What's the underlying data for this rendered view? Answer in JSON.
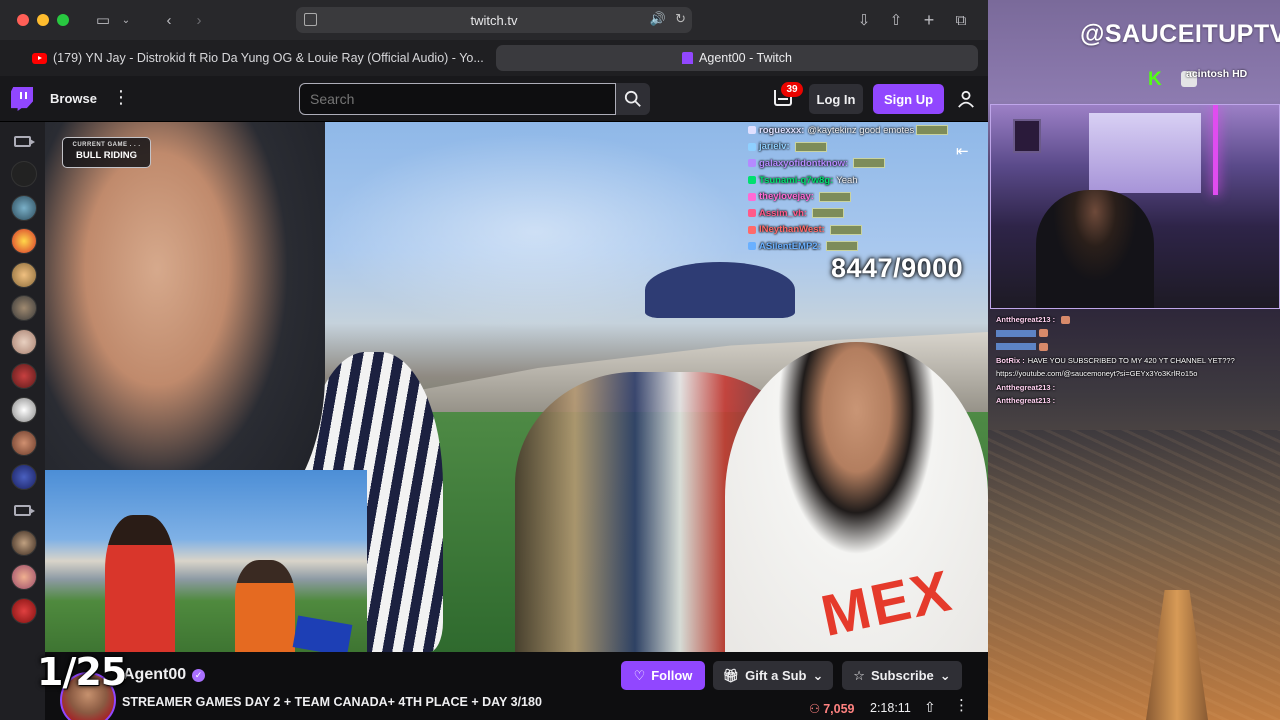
{
  "browser": {
    "url": "twitch.tv",
    "tabs": [
      {
        "label": "(179) YN Jay - Distrokid ft Rio Da Yung OG & Louie Ray (Official Audio) - Yo...",
        "favicon": "youtube-icon",
        "active": false
      },
      {
        "label": "Agent00 - Twitch",
        "favicon": "twitch-icon",
        "active": true
      }
    ]
  },
  "twitch_nav": {
    "browse": "Browse",
    "search_placeholder": "Search",
    "notifications_count": "39",
    "login": "Log In",
    "signup": "Sign Up"
  },
  "video": {
    "game_badge_small": "CURRENT GAME . . .",
    "game_badge_big": "BULL RIDING",
    "counter": "8447/9000",
    "chat": [
      {
        "name": "roguexxx:",
        "text": "@kaytekinz good emotes",
        "color": "#e0e0ff",
        "emote": true
      },
      {
        "name": "jarielv:",
        "text": "",
        "color": "#8fd0ff",
        "emote": true
      },
      {
        "name": "galaxyofidontknow:",
        "text": "",
        "color": "#b48aff",
        "emote": true
      },
      {
        "name": "Tsunami-q7w8g:",
        "text": "Yeah",
        "color": "#00e070",
        "emote": false
      },
      {
        "name": "theylovejay:",
        "text": "",
        "color": "#ff6ad5",
        "emote": true
      },
      {
        "name": "Assim_vh:",
        "text": "",
        "color": "#ff5a8a",
        "emote": true
      },
      {
        "name": "INeythanWest:",
        "text": "",
        "color": "#ff6a6a",
        "emote": true
      },
      {
        "name": "ASilentEMP2:",
        "text": "",
        "color": "#6ab0ff",
        "emote": true
      }
    ],
    "shirt_text": "MEX"
  },
  "episode_counter": "1/25",
  "channel": {
    "name": "Agent00",
    "title": "STREAMER GAMES DAY 2 + TEAM CANADA+ 4TH PLACE + DAY 3/180",
    "follow": "Follow",
    "gift": "Gift a Sub",
    "subscribe": "Subscribe",
    "viewers": "7,059",
    "uptime": "2:18:11"
  },
  "overlay": {
    "handle": "@SAUCEITUPTV",
    "drive_label": "acintosh HD",
    "chat": [
      {
        "name": "Antthegreat213 :",
        "text": "",
        "emote": true
      },
      {
        "name": "",
        "text": "",
        "emote": true
      },
      {
        "name": "",
        "text": "",
        "emote": true
      },
      {
        "name": "BotRix :",
        "text": "HAVE YOU SUBSCRIBED TO MY 420 YT CHANNEL YET???",
        "emote": false
      },
      {
        "name": "",
        "text": "https://youtube.com/@saucemoneyt?si=GEYx3Yo3KrlRo15o",
        "emote": false
      },
      {
        "name": "Antthegreat213 :",
        "text": "",
        "emote": false
      },
      {
        "name": "Antthegreat213 :",
        "text": "",
        "emote": false
      }
    ]
  },
  "colors": {
    "twitch_purple": "#9147ff",
    "twitch_bg": "#18181b",
    "viewer_red": "#ff8280"
  }
}
